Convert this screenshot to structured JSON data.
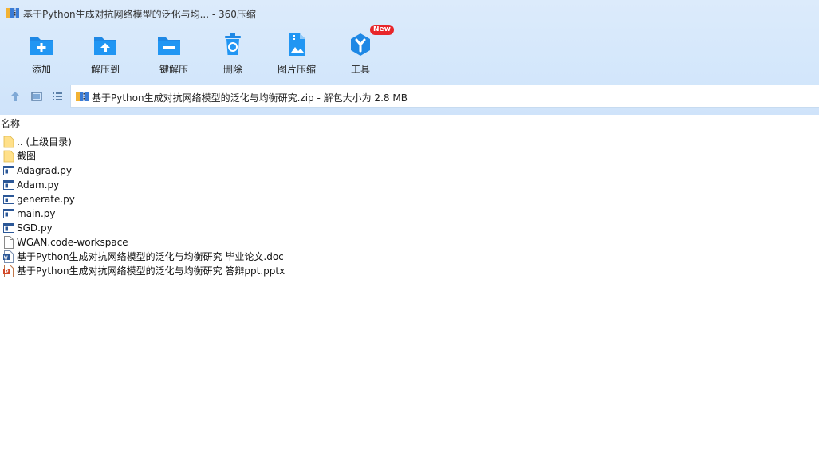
{
  "window": {
    "title": "基于Python生成对抗网络模型的泛化与均... - 360压缩"
  },
  "toolbar": {
    "items": [
      {
        "label": "添加",
        "icon": "add-folder-icon"
      },
      {
        "label": "解压到",
        "icon": "extract-to-folder-icon"
      },
      {
        "label": "一键解压",
        "icon": "one-click-extract-icon"
      },
      {
        "label": "删除",
        "icon": "recycle-bin-icon"
      },
      {
        "label": "图片压缩",
        "icon": "image-compress-icon"
      },
      {
        "label": "工具",
        "icon": "tools-icon",
        "badge": "New"
      }
    ]
  },
  "address": {
    "text": "基于Python生成对抗网络模型的泛化与均衡研究.zip - 解包大小为 2.8 MB"
  },
  "list": {
    "column_header": "名称",
    "rows": [
      {
        "name": ".. (上级目录)",
        "icon": "parent-folder-icon"
      },
      {
        "name": "截图",
        "icon": "folder-icon"
      },
      {
        "name": "Adagrad.py",
        "icon": "python-file-icon"
      },
      {
        "name": "Adam.py",
        "icon": "python-file-icon"
      },
      {
        "name": "generate.py",
        "icon": "python-file-icon"
      },
      {
        "name": "main.py",
        "icon": "python-file-icon"
      },
      {
        "name": "SGD.py",
        "icon": "python-file-icon"
      },
      {
        "name": "WGAN.code-workspace",
        "icon": "blank-file-icon"
      },
      {
        "name": "基于Python生成对抗网络模型的泛化与均衡研究 毕业论文.doc",
        "icon": "word-doc-icon"
      },
      {
        "name": "基于Python生成对抗网络模型的泛化与均衡研究 答辩ppt.pptx",
        "icon": "powerpoint-file-icon"
      }
    ]
  },
  "colors": {
    "accent": "#1e88e5",
    "toolbar_bg": "#d6e8fb",
    "badge": "#e8262a"
  }
}
